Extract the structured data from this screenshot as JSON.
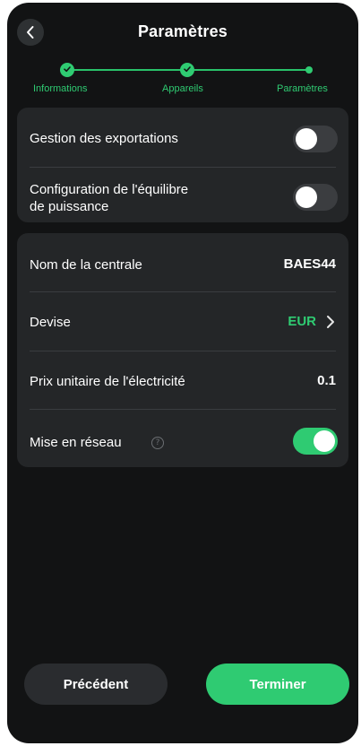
{
  "header": {
    "title": "Paramètres"
  },
  "stepper": {
    "steps": [
      {
        "label": "Informations",
        "state": "done"
      },
      {
        "label": "Appareils",
        "state": "done"
      },
      {
        "label": "Paramètres",
        "state": "current"
      }
    ]
  },
  "card1": {
    "export_management": {
      "label": "Gestion des exportations",
      "enabled": false
    },
    "power_balance": {
      "label": "Configuration de l'équilibre de puissance",
      "label_line1": "Configuration de l'équilibre",
      "label_line2": "de puissance",
      "enabled": false
    }
  },
  "card2": {
    "plant_name": {
      "label": "Nom de la centrale",
      "value": "BAES44"
    },
    "currency": {
      "label": "Devise",
      "value": "EUR"
    },
    "unit_price": {
      "label": "Prix unitaire de l'électricité",
      "value": "0.1"
    },
    "networking": {
      "label": "Mise en réseau",
      "enabled": true,
      "help_glyph": "?"
    }
  },
  "footer": {
    "previous_label": "Précédent",
    "finish_label": "Terminer"
  },
  "colors": {
    "accent": "#2fcb72",
    "background": "#121314",
    "card": "#242628"
  },
  "icons": {
    "back": "chevron-left-icon",
    "step_done": "check-icon",
    "row_chevron": "chevron-right-icon",
    "help": "question-circle-icon"
  }
}
